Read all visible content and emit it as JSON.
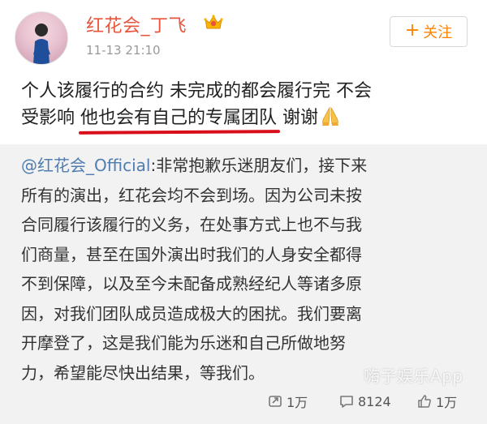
{
  "post": {
    "username": "红花会_丁飞",
    "timestamp": "11-13 21:10",
    "follow_label": "关注",
    "text_line1": "个人该履行的合约 未完成的都会履行完 不会",
    "text_line2_prefix": "受影响 ",
    "text_line2_underlined": "他也会有自己的专属团队",
    "text_line2_suffix": " 谢谢"
  },
  "repost": {
    "mention": "@红花会_Official",
    "lines": [
      ":非常抱歉乐迷朋友们，接下来",
      "所有的演出，红花会均不会到场。因为公司未按",
      "合同履行该履行的义务，在处事方式上也不与我",
      "们商量，甚至在国外演出时我们的人身安全都得",
      "不到保障，以及至今未配备成熟经纪人等诸多原",
      "因，对我们团队成员造成极大的困扰。我们要离",
      "开摩登了，这是我们能为乐迷和自己所做地努",
      "力，希望能尽快出结果，等我们。"
    ],
    "stats": {
      "reposts": "1万",
      "comments": "8124",
      "likes": "1万"
    }
  },
  "watermark": "嗨子娱乐App",
  "colors": {
    "username": "#e8543c",
    "follow": "#ff8200",
    "mention": "#507daf",
    "underline": "#d80f1a"
  },
  "icons": {
    "crown_badge": "crown-badge-icon",
    "pray": "pray-hands-icon",
    "repost": "repost-icon",
    "comment": "comment-icon",
    "like": "like-icon"
  }
}
